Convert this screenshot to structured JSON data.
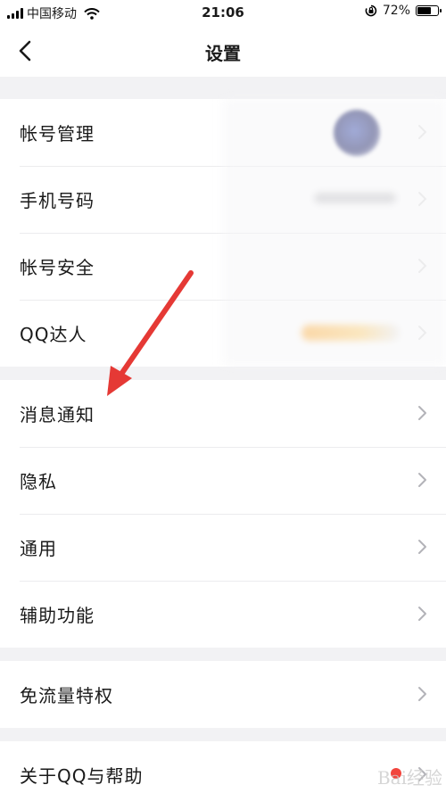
{
  "status_bar": {
    "carrier": "中国移动",
    "time": "21:06",
    "battery_percent": "72%",
    "battery_level": 0.72
  },
  "nav": {
    "title": "设置"
  },
  "groups": [
    {
      "items": [
        "帐号管理",
        "手机号码",
        "帐号安全",
        "QQ达人"
      ]
    },
    {
      "items": [
        "消息通知",
        "隐私",
        "通用",
        "辅助功能"
      ]
    },
    {
      "items": [
        "免流量特权"
      ]
    },
    {
      "items": [
        "关于QQ与帮助"
      ]
    }
  ],
  "icons": {
    "back": "chevron-left-icon",
    "row_arrow": "chevron-right-icon",
    "wifi": "wifi-icon",
    "orientation_lock": "orientation-lock-icon"
  },
  "colors": {
    "annotation_arrow": "#e53935",
    "badge_dot": "#f2453d",
    "background": "#f2f2f4"
  },
  "watermark": "Bai经验"
}
